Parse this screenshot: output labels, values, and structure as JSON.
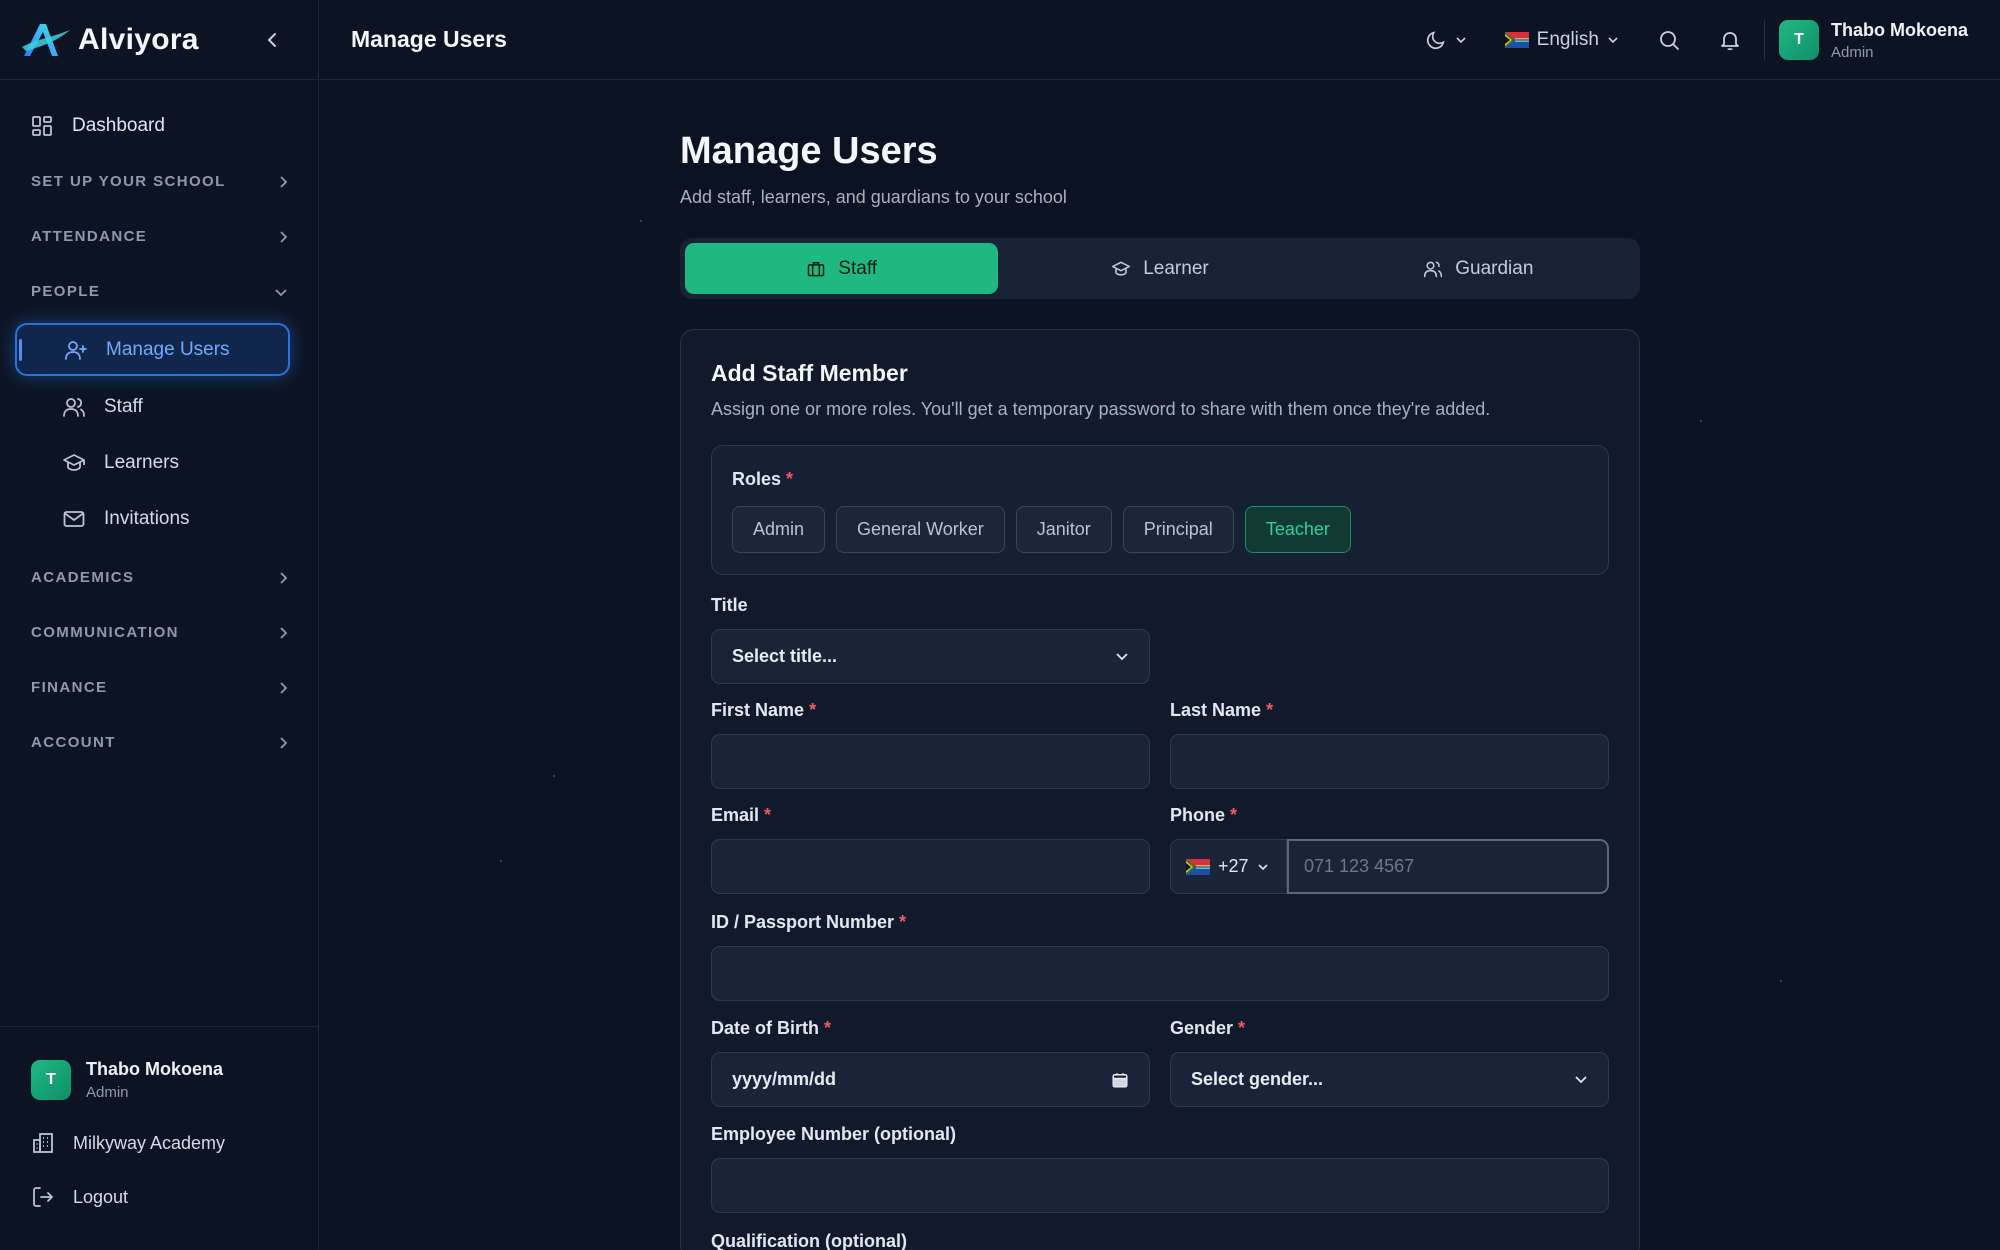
{
  "app": {
    "brand": "Alviyora",
    "topbar_title": "Manage Users"
  },
  "sidebar": {
    "dashboard": "Dashboard",
    "sections": {
      "setup": "SET UP YOUR SCHOOL",
      "attendance": "ATTENDANCE",
      "people": "PEOPLE",
      "academics": "ACADEMICS",
      "communication": "COMMUNICATION",
      "finance": "FINANCE",
      "account": "ACCOUNT"
    },
    "people_items": [
      {
        "label": "Manage Users",
        "icon": "user-plus-icon",
        "active": true
      },
      {
        "label": "Staff",
        "icon": "users-icon"
      },
      {
        "label": "Learners",
        "icon": "graduation-cap-icon"
      },
      {
        "label": "Invitations",
        "icon": "mail-icon"
      }
    ],
    "footer": {
      "avatar_initial": "T",
      "user_name": "Thabo Mokoena",
      "user_role": "Admin",
      "school": "Milkyway Academy",
      "logout": "Logout"
    }
  },
  "topbar": {
    "language": "English",
    "avatar_initial": "T",
    "user_name": "Thabo Mokoena",
    "user_role": "Admin"
  },
  "main": {
    "title": "Manage Users",
    "subtitle": "Add staff, learners, and guardians to your school",
    "tabs": [
      {
        "label": "Staff",
        "icon": "briefcase-icon",
        "active": true
      },
      {
        "label": "Learner",
        "icon": "graduation-cap-icon"
      },
      {
        "label": "Guardian",
        "icon": "users-icon"
      }
    ]
  },
  "form": {
    "title": "Add Staff Member",
    "subtitle": "Assign one or more roles. You'll get a temporary password to share with them once they're added.",
    "roles_label": "Roles",
    "roles": [
      {
        "label": "Admin",
        "selected": false
      },
      {
        "label": "General Worker",
        "selected": false
      },
      {
        "label": "Janitor",
        "selected": false
      },
      {
        "label": "Principal",
        "selected": false
      },
      {
        "label": "Teacher",
        "selected": true
      }
    ],
    "title_label": "Title",
    "title_placeholder": "Select title...",
    "first_name_label": "First Name",
    "last_name_label": "Last Name",
    "email_label": "Email",
    "phone_label": "Phone",
    "phone_code": "+27",
    "phone_placeholder": "071 123 4567",
    "id_label": "ID / Passport Number",
    "dob_label": "Date of Birth",
    "dob_placeholder": "yyyy/mm/dd",
    "gender_label": "Gender",
    "gender_placeholder": "Select gender...",
    "employee_label": "Employee Number (optional)",
    "qualification_label": "Qualification (optional)",
    "required_mark": "*"
  },
  "colors": {
    "accent": "#1fb883",
    "active_nav": "#2b73d6",
    "required": "#ef5a63",
    "background": "#0b1221"
  }
}
